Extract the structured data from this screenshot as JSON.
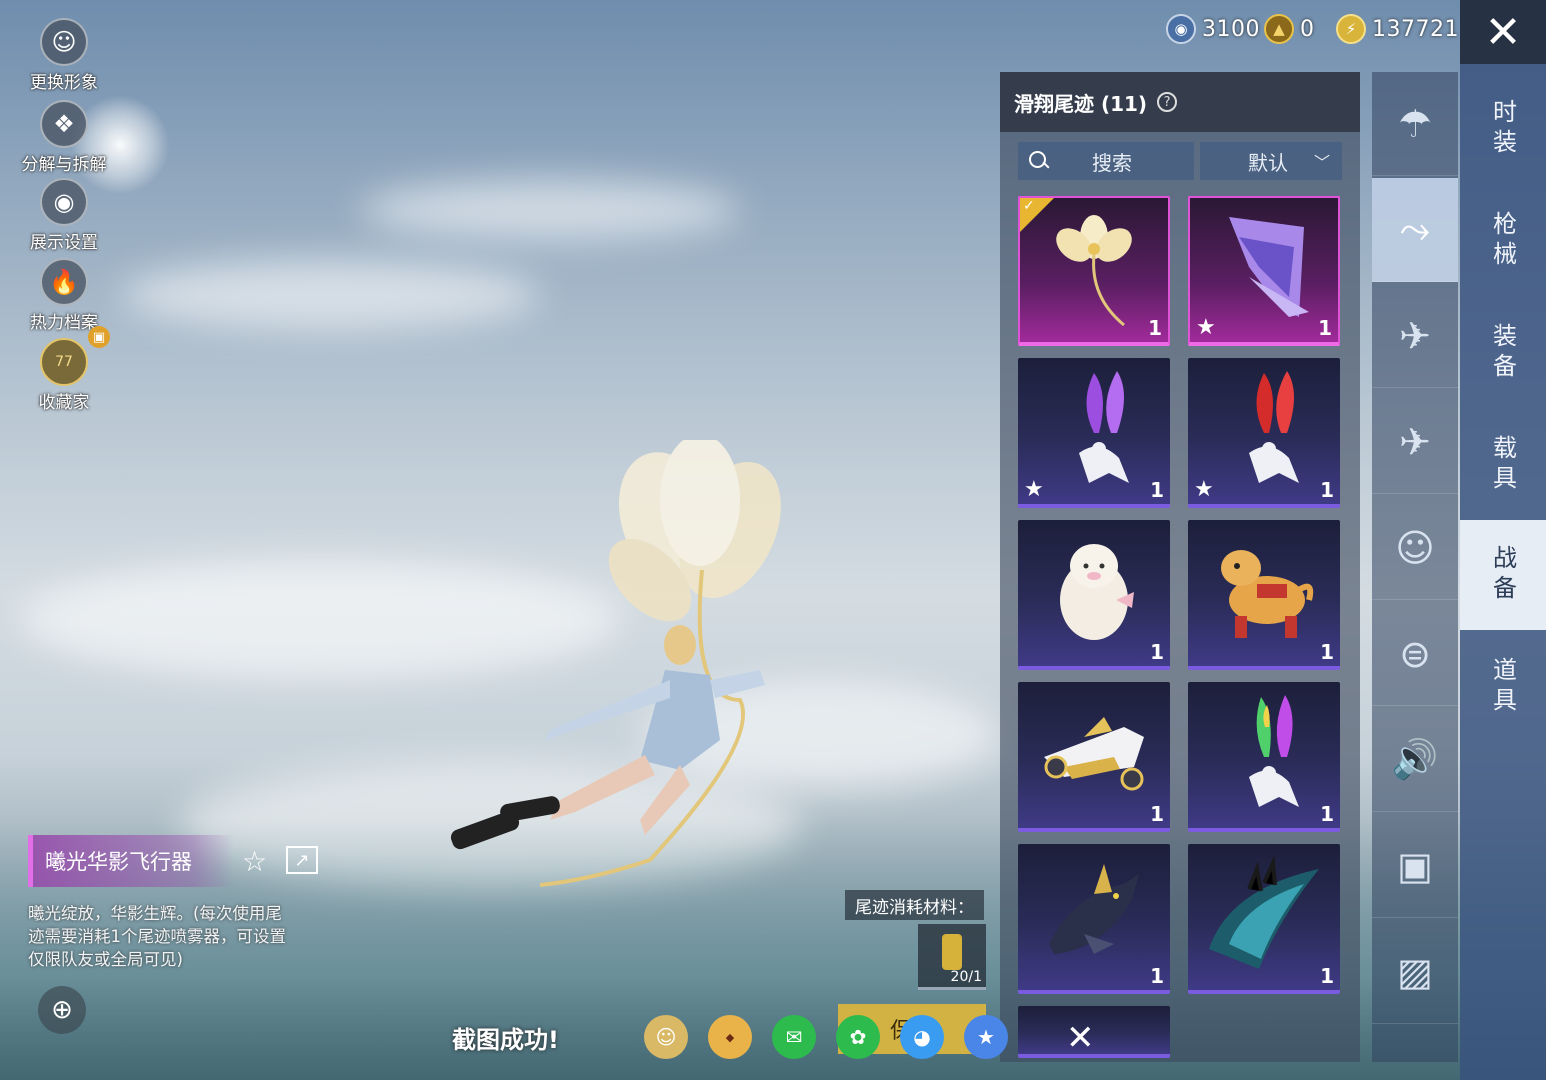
{
  "left_menu": [
    {
      "label": "更换形象",
      "icon": "avatar-icon"
    },
    {
      "label": "分解与拆解",
      "icon": "puzzle-icon"
    },
    {
      "label": "展示设置",
      "icon": "eye-icon"
    },
    {
      "label": "热力档案",
      "icon": "flame-icon"
    },
    {
      "label": "收藏家",
      "icon": "collector-badge-icon",
      "badge_text": "77"
    }
  ],
  "currency": [
    {
      "icon": "silver-coin-icon",
      "value": "3100",
      "color": "#4a6fa5"
    },
    {
      "icon": "gold-coin-icon",
      "value": "0",
      "color": "#c9a227"
    },
    {
      "icon": "lightning-coin-icon",
      "value": "137721",
      "color": "#e3c23a"
    }
  ],
  "panel": {
    "title": "滑翔尾迹 (11)",
    "search_placeholder": "搜索",
    "sort_label": "默认"
  },
  "items": [
    {
      "kind": "flower-glider",
      "count": "1",
      "starred": false,
      "equipped": true,
      "rarity": "pink"
    },
    {
      "kind": "purple-glider",
      "count": "1",
      "starred": true,
      "equipped": false,
      "rarity": "pink"
    },
    {
      "kind": "purple-smoke-trail",
      "count": "1",
      "starred": true,
      "equipped": false,
      "rarity": "purple"
    },
    {
      "kind": "red-smoke-trail",
      "count": "1",
      "starred": true,
      "equipped": false,
      "rarity": "purple"
    },
    {
      "kind": "alpaca-glider",
      "count": "1",
      "starred": false,
      "equipped": false,
      "rarity": "purple"
    },
    {
      "kind": "pony-glider",
      "count": "1",
      "starred": false,
      "equipped": false,
      "rarity": "purple"
    },
    {
      "kind": "jet-glider",
      "count": "1",
      "starred": false,
      "equipped": false,
      "rarity": "purple"
    },
    {
      "kind": "rainbow-smoke-trail",
      "count": "1",
      "starred": false,
      "equipped": false,
      "rarity": "purple"
    },
    {
      "kind": "shark-glider",
      "count": "1",
      "starred": false,
      "equipped": false,
      "rarity": "purple"
    },
    {
      "kind": "wing-glider",
      "count": "1",
      "starred": false,
      "equipped": false,
      "rarity": "purple"
    }
  ],
  "categories": [
    {
      "icon": "parachute-icon",
      "active": false
    },
    {
      "icon": "skydiver-icon",
      "active": true
    },
    {
      "icon": "drone-icon",
      "active": false
    },
    {
      "icon": "airplane-icon",
      "active": false
    },
    {
      "icon": "emote-face-icon",
      "active": false
    },
    {
      "icon": "robot-icon",
      "active": false
    },
    {
      "icon": "speaker-icon",
      "active": false
    },
    {
      "icon": "chat-bubble-icon",
      "active": false
    },
    {
      "icon": "gallery-icon",
      "active": false
    }
  ],
  "tabs": [
    {
      "label": "时装",
      "active": false
    },
    {
      "label": "枪械",
      "active": false
    },
    {
      "label": "装备",
      "active": false
    },
    {
      "label": "载具",
      "active": false
    },
    {
      "label": "战备",
      "active": true
    },
    {
      "label": "道具",
      "active": false
    }
  ],
  "selected": {
    "name": "曦光华影飞行器",
    "description": "曦光绽放，华影生辉。(每次使用尾迹需要消耗1个尾迹喷雾器，可设置仅限队友或全局可见)"
  },
  "material": {
    "label": "尾迹消耗材料：",
    "count": "20/1"
  },
  "screenshot": {
    "message": "截图成功!",
    "save_label": "保存"
  }
}
